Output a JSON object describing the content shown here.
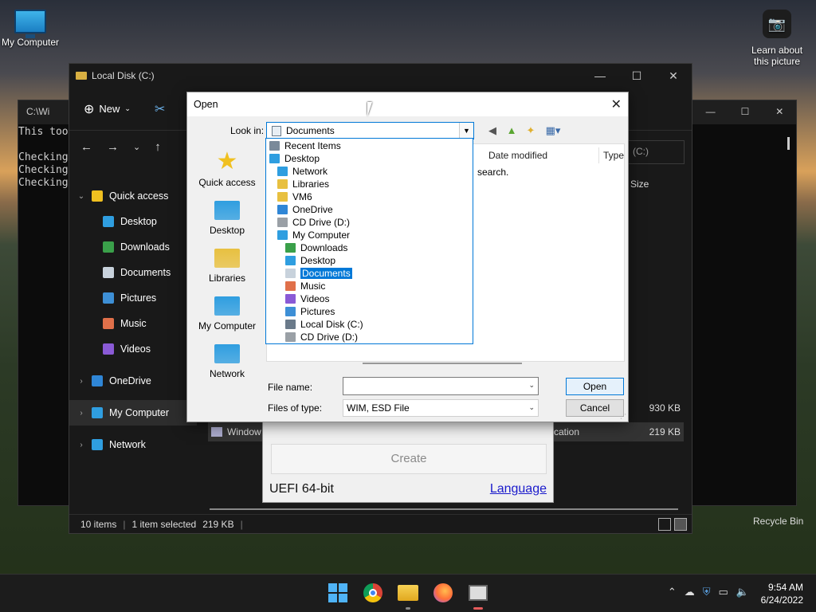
{
  "desktop": {
    "my_computer_label": "My Computer",
    "learn_label": "Learn about this picture",
    "recycle_label": "Recycle Bin"
  },
  "cmd": {
    "title": "C:\\Wi",
    "lines": [
      "This too",
      "",
      "Checking",
      "Checking",
      "Checking"
    ]
  },
  "explorer": {
    "title": "Local Disk (C:)",
    "new_label": "New",
    "sidebar": [
      {
        "label": "Quick access",
        "icon": "star-icon",
        "chev": "⌄"
      },
      {
        "label": "Desktop",
        "icon": "desktop-icon",
        "pin": true
      },
      {
        "label": "Downloads",
        "icon": "download-icon",
        "pin": true
      },
      {
        "label": "Documents",
        "icon": "document-icon",
        "pin": true
      },
      {
        "label": "Pictures",
        "icon": "pictures-icon",
        "pin": true
      },
      {
        "label": "Music",
        "icon": "music-icon"
      },
      {
        "label": "Videos",
        "icon": "videos-icon"
      },
      {
        "label": "OneDrive",
        "icon": "cloud-icon",
        "chev": "›"
      },
      {
        "label": "My Computer",
        "icon": "monitor-icon",
        "chev": "›"
      },
      {
        "label": "Network",
        "icon": "network-icon",
        "chev": "›"
      }
    ],
    "search_hint": "(C:)",
    "col_size": "Size",
    "row1_size": "930 KB",
    "row2_name": "Window",
    "row2_type": "cation",
    "row2_size": "219 KB",
    "status_items": "10 items",
    "status_selected": "1 item selected",
    "status_size": "219 KB"
  },
  "rufus": {
    "create_label": "Create",
    "footer_text": "UEFI 64-bit",
    "language_link": "Language"
  },
  "dialog": {
    "title": "Open",
    "look_in_label": "Look in:",
    "look_in_value": "Documents",
    "places": [
      {
        "label": "Quick access",
        "icon": "star-icon"
      },
      {
        "label": "Desktop",
        "icon": "desktop-icon"
      },
      {
        "label": "Libraries",
        "icon": "folder-icon"
      },
      {
        "label": "My Computer",
        "icon": "monitor-icon"
      },
      {
        "label": "Network",
        "icon": "network-icon"
      }
    ],
    "col_date": "Date modified",
    "col_type": "Type",
    "empty_hint": "search.",
    "dropdown": [
      {
        "label": "Recent Items",
        "indent": 0,
        "icon": "recent-icon"
      },
      {
        "label": "Desktop",
        "indent": 0,
        "icon": "desktop-icon"
      },
      {
        "label": "Network",
        "indent": 1,
        "icon": "network-icon"
      },
      {
        "label": "Libraries",
        "indent": 1,
        "icon": "folder-icon"
      },
      {
        "label": "VM6",
        "indent": 1,
        "icon": "folder-icon"
      },
      {
        "label": "OneDrive",
        "indent": 1,
        "icon": "cloud-icon"
      },
      {
        "label": "CD Drive (D:)",
        "indent": 1,
        "icon": "drive-icon"
      },
      {
        "label": "My Computer",
        "indent": 1,
        "icon": "monitor-icon"
      },
      {
        "label": "Downloads",
        "indent": 2,
        "icon": "download-icon"
      },
      {
        "label": "Desktop",
        "indent": 2,
        "icon": "desktop-icon"
      },
      {
        "label": "Documents",
        "indent": 2,
        "icon": "document-icon",
        "selected": true
      },
      {
        "label": "Music",
        "indent": 2,
        "icon": "music-icon"
      },
      {
        "label": "Videos",
        "indent": 2,
        "icon": "videos-icon"
      },
      {
        "label": "Pictures",
        "indent": 2,
        "icon": "pictures-icon"
      },
      {
        "label": "Local Disk (C:)",
        "indent": 2,
        "icon": "disk-icon"
      },
      {
        "label": "CD Drive (D:)",
        "indent": 2,
        "icon": "drive-icon"
      }
    ],
    "file_name_label": "File name:",
    "file_name_value": "",
    "files_of_type_label": "Files of type:",
    "files_of_type_value": "WIM, ESD File",
    "open_button": "Open",
    "cancel_button": "Cancel"
  },
  "taskbar": {
    "time": "9:54 AM",
    "date": "6/24/2022"
  },
  "colors": {
    "accent": "#0078d7",
    "selection": "#0078d7"
  }
}
